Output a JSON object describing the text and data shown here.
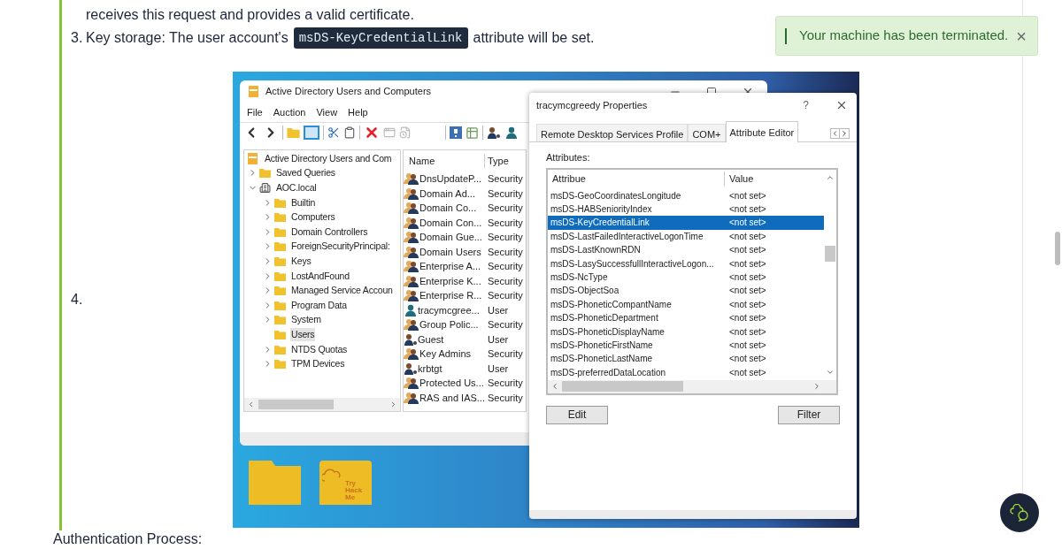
{
  "continuation": "receives this request and provides a valid certificate.",
  "steps": [
    {
      "number": "3.",
      "text_before": "Key storage: The user account's",
      "code": "msDS-KeyCredentialLink",
      "text_after": "attribute will be set."
    },
    {
      "number": "4."
    }
  ],
  "toast": {
    "message": "Your machine has been terminated.",
    "close": "×"
  },
  "screenshot": {
    "aduc": {
      "title": "Active Directory Users and Computers",
      "menu": [
        "File",
        "Auction",
        "View",
        "Help"
      ],
      "tree": [
        {
          "label": "Active Directory Users and Com",
          "kind": "console",
          "selected": false,
          "children": [
            {
              "label": "Saved Queries",
              "kind": "folder",
              "expanded": false,
              "selected": false
            },
            {
              "label": "AOC.local",
              "kind": "domain",
              "expanded": true,
              "selected": false,
              "children": [
                {
                  "label": "Builtin",
                  "kind": "folder",
                  "expanded": false,
                  "selected": false
                },
                {
                  "label": "Computers",
                  "kind": "folder",
                  "expanded": false,
                  "selected": false
                },
                {
                  "label": "Domain Controllers",
                  "kind": "folder",
                  "expanded": false,
                  "selected": false
                },
                {
                  "label": "ForeignSecurityPrincipal:",
                  "kind": "folder",
                  "expanded": false,
                  "selected": false
                },
                {
                  "label": "Keys",
                  "kind": "folder",
                  "expanded": false,
                  "selected": false
                },
                {
                  "label": "LostAndFound",
                  "kind": "folder",
                  "expanded": false,
                  "selected": false
                },
                {
                  "label": "Managed Service Accoun",
                  "kind": "folder",
                  "expanded": false,
                  "selected": false
                },
                {
                  "label": "Program Data",
                  "kind": "folder",
                  "expanded": false,
                  "selected": false
                },
                {
                  "label": "System",
                  "kind": "folder",
                  "expanded": false,
                  "selected": false
                },
                {
                  "label": "Users",
                  "kind": "folder",
                  "selected": true
                },
                {
                  "label": "NTDS Quotas",
                  "kind": "folder",
                  "expanded": false,
                  "selected": false
                },
                {
                  "label": "TPM Devices",
                  "kind": "folder",
                  "expanded": false,
                  "selected": false
                }
              ]
            }
          ]
        }
      ],
      "list": {
        "columns": [
          "Name",
          "Type"
        ],
        "rows": [
          {
            "name": "DnsUpdateP...",
            "type": "Security",
            "kind": "group"
          },
          {
            "name": "Domain Ad...",
            "type": "Security",
            "kind": "group"
          },
          {
            "name": "Domain Co...",
            "type": "Security",
            "kind": "group"
          },
          {
            "name": "Domain Con...",
            "type": "Security",
            "kind": "group"
          },
          {
            "name": "Domain Gue...",
            "type": "Security",
            "kind": "group"
          },
          {
            "name": "Domain Users",
            "type": "Security",
            "kind": "group"
          },
          {
            "name": "Enterprise A...",
            "type": "Security",
            "kind": "group"
          },
          {
            "name": "Enterprise K...",
            "type": "Security",
            "kind": "group"
          },
          {
            "name": "Enterprise R...",
            "type": "Security",
            "kind": "group"
          },
          {
            "name": "tracymcgree...",
            "type": "User",
            "kind": "user"
          },
          {
            "name": "Group Polic...",
            "type": "Security",
            "kind": "group"
          },
          {
            "name": "Guest",
            "type": "User",
            "kind": "disabled-user"
          },
          {
            "name": "Key Admins",
            "type": "Security",
            "kind": "group"
          },
          {
            "name": "krbtgt",
            "type": "User",
            "kind": "disabled-user"
          },
          {
            "name": "Protected Us...",
            "type": "Security",
            "kind": "group"
          },
          {
            "name": "RAS and IAS...",
            "type": "Security",
            "kind": "group"
          }
        ]
      }
    },
    "properties": {
      "title": "tracymcgreedy Properties",
      "help": "?",
      "tabs": [
        {
          "label": "Remote Desktop Services Profile",
          "selected": false
        },
        {
          "label": "COM+",
          "selected": false
        },
        {
          "label": "Attribute Editor",
          "selected": true
        }
      ],
      "attributes_label": "Attributes:",
      "columns": [
        "Attribue",
        "Value"
      ],
      "rows": [
        {
          "attribute": "msDS-GeoCoordinatesLongitude",
          "value": "<not set>",
          "selected": false
        },
        {
          "attribute": "msDS-HABSeniorityIndex",
          "value": "<not set>",
          "selected": false
        },
        {
          "attribute": "msDS-KeyCredentialLink",
          "value": "<not set>",
          "selected": true
        },
        {
          "attribute": "msDS-LastFailedInteractiveLogonTime",
          "value": "<not set>",
          "selected": false
        },
        {
          "attribute": "msDS-LastKnownRDN",
          "value": "<not set>",
          "selected": false
        },
        {
          "attribute": "msDS-LasySuccessfullInteractiveLogon...",
          "value": "<not set>",
          "selected": false
        },
        {
          "attribute": "msDS-NcType",
          "value": "<not set>",
          "selected": false
        },
        {
          "attribute": "msDS-ObjectSoa",
          "value": "<not set>",
          "selected": false
        },
        {
          "attribute": "msDS-PhoneticCompantName",
          "value": "<not set>",
          "selected": false
        },
        {
          "attribute": "msDS-PhoneticDepartment",
          "value": "<not set>",
          "selected": false
        },
        {
          "attribute": "msDS-PhoneticDisplayName",
          "value": "<not set>",
          "selected": false
        },
        {
          "attribute": "msDS-PhoneticFirstName",
          "value": "<not set>",
          "selected": false
        },
        {
          "attribute": "msDS-PhoneticLastName",
          "value": "<not set>",
          "selected": false
        },
        {
          "attribute": "msDS-preferredDataLocation",
          "value": "<not set>",
          "selected": false
        }
      ],
      "buttons": [
        "Edit",
        "Filter"
      ]
    },
    "desktop_icons": [
      {
        "kind": "folder"
      },
      {
        "kind": "logo-folder",
        "label": "Try Hack Me"
      }
    ]
  },
  "footer_heading": "Authentication Process:"
}
